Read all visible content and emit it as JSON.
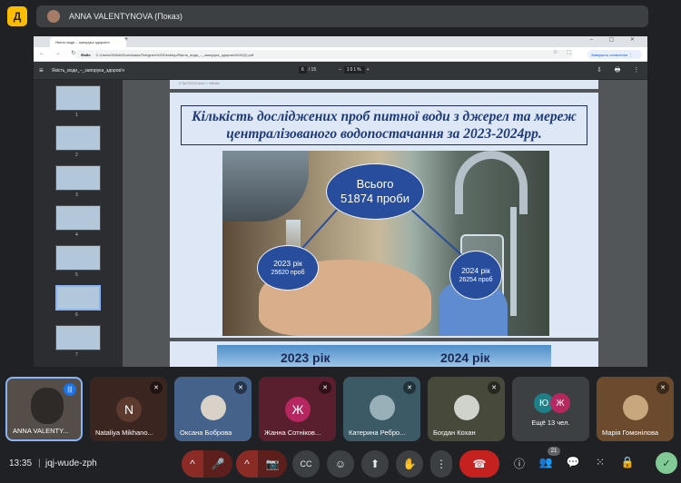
{
  "meeting": {
    "app_logo": "Д",
    "presenter_label": "ANNA VALENTYNOVA (Показ)",
    "time": "13:35",
    "separator": "|",
    "meeting_code": "jqj-wude-zph",
    "participant_count": "21"
  },
  "browser": {
    "tab_title": "Якість води – запорука здоров’я",
    "new_tab": "+",
    "window_controls": "– ▢ ✕",
    "nav_icons": "← → ↻",
    "url_scheme": "Файл",
    "url": "C:/Users/ANNA/Downloads/Telegram%20Desktop/Якість_води_–_запорука_здоров'я%20(2).pdf",
    "url_icons": "☆ ⬚",
    "update_button": "Завершіть оновлення ⋮"
  },
  "pdf_viewer": {
    "menu_icon": "≡",
    "title": "Якість_води_–_запорука_здоров'я",
    "current_page": "6",
    "total_pages": "/ 15",
    "zoom_value": "101%",
    "zoom_controls": [
      "–",
      "+"
    ],
    "actions": "⇩ 🖶 ⋮",
    "page_header_strip": "5  №7/2023  Acid + Nitrate",
    "thumbnails": [
      "1",
      "2",
      "3",
      "4",
      "5",
      "6",
      "7"
    ]
  },
  "slide": {
    "title": "Кількість досліджених проб питної води з джерел та мереж централізованого водопостачання за 2023-2024рр.",
    "total_label": "Всього",
    "total_value": "51874 проби",
    "y2023_label": "2023 рік",
    "y2023_value": "25620 проб",
    "y2024_label": "2024 рік",
    "y2024_value": "26254 проб",
    "next_slide_left": "2023 рік",
    "next_slide_right": "2024 рік"
  },
  "participants": [
    {
      "name": "ANNA VALENTY...",
      "avatar": "",
      "mic": "speaking"
    },
    {
      "name": "Nataliya Mikhano...",
      "avatar": "N",
      "avatar_color": "#5c3a2e",
      "mic": "muted"
    },
    {
      "name": "Оксана Боброва",
      "avatar": "",
      "mic": "muted"
    },
    {
      "name": "Жанна Сотніков...",
      "avatar": "Ж",
      "avatar_color": "#b5275e",
      "mic": "muted"
    },
    {
      "name": "Катерина Ребро...",
      "avatar": "",
      "mic": "muted"
    },
    {
      "name": "Богдан Кохан",
      "avatar": "",
      "mic": "muted"
    },
    {
      "name": "Ещё 13 чел.",
      "avatars": [
        "Ю",
        "Ж"
      ],
      "avatar_colors": [
        "#1e7f86",
        "#b5275e"
      ]
    },
    {
      "name": "Марія Гомонілова",
      "avatar": "",
      "mic": "muted"
    }
  ],
  "controls": {
    "mic_icon": "🎤",
    "cam_icon": "📷",
    "captions_icon": "CC",
    "emoji_icon": "☺",
    "present_icon": "⬆",
    "hand_icon": "✋",
    "more_icon": "⋮",
    "leave_icon": "☎",
    "chevron_icon": "^",
    "info_icon": "ⓘ",
    "people_icon": "👥",
    "chat_icon": "💬",
    "activities_icon": "⁙",
    "lock_icon": "🔒",
    "host_icon": "✓"
  },
  "colors": {
    "meet_bg": "#202124",
    "slide_bg": "#dde7f5",
    "oval_blue": "#274d9c",
    "title_blue": "#1f3a7a",
    "leave_red": "#c5221f",
    "accent": "#8ab4f8"
  }
}
